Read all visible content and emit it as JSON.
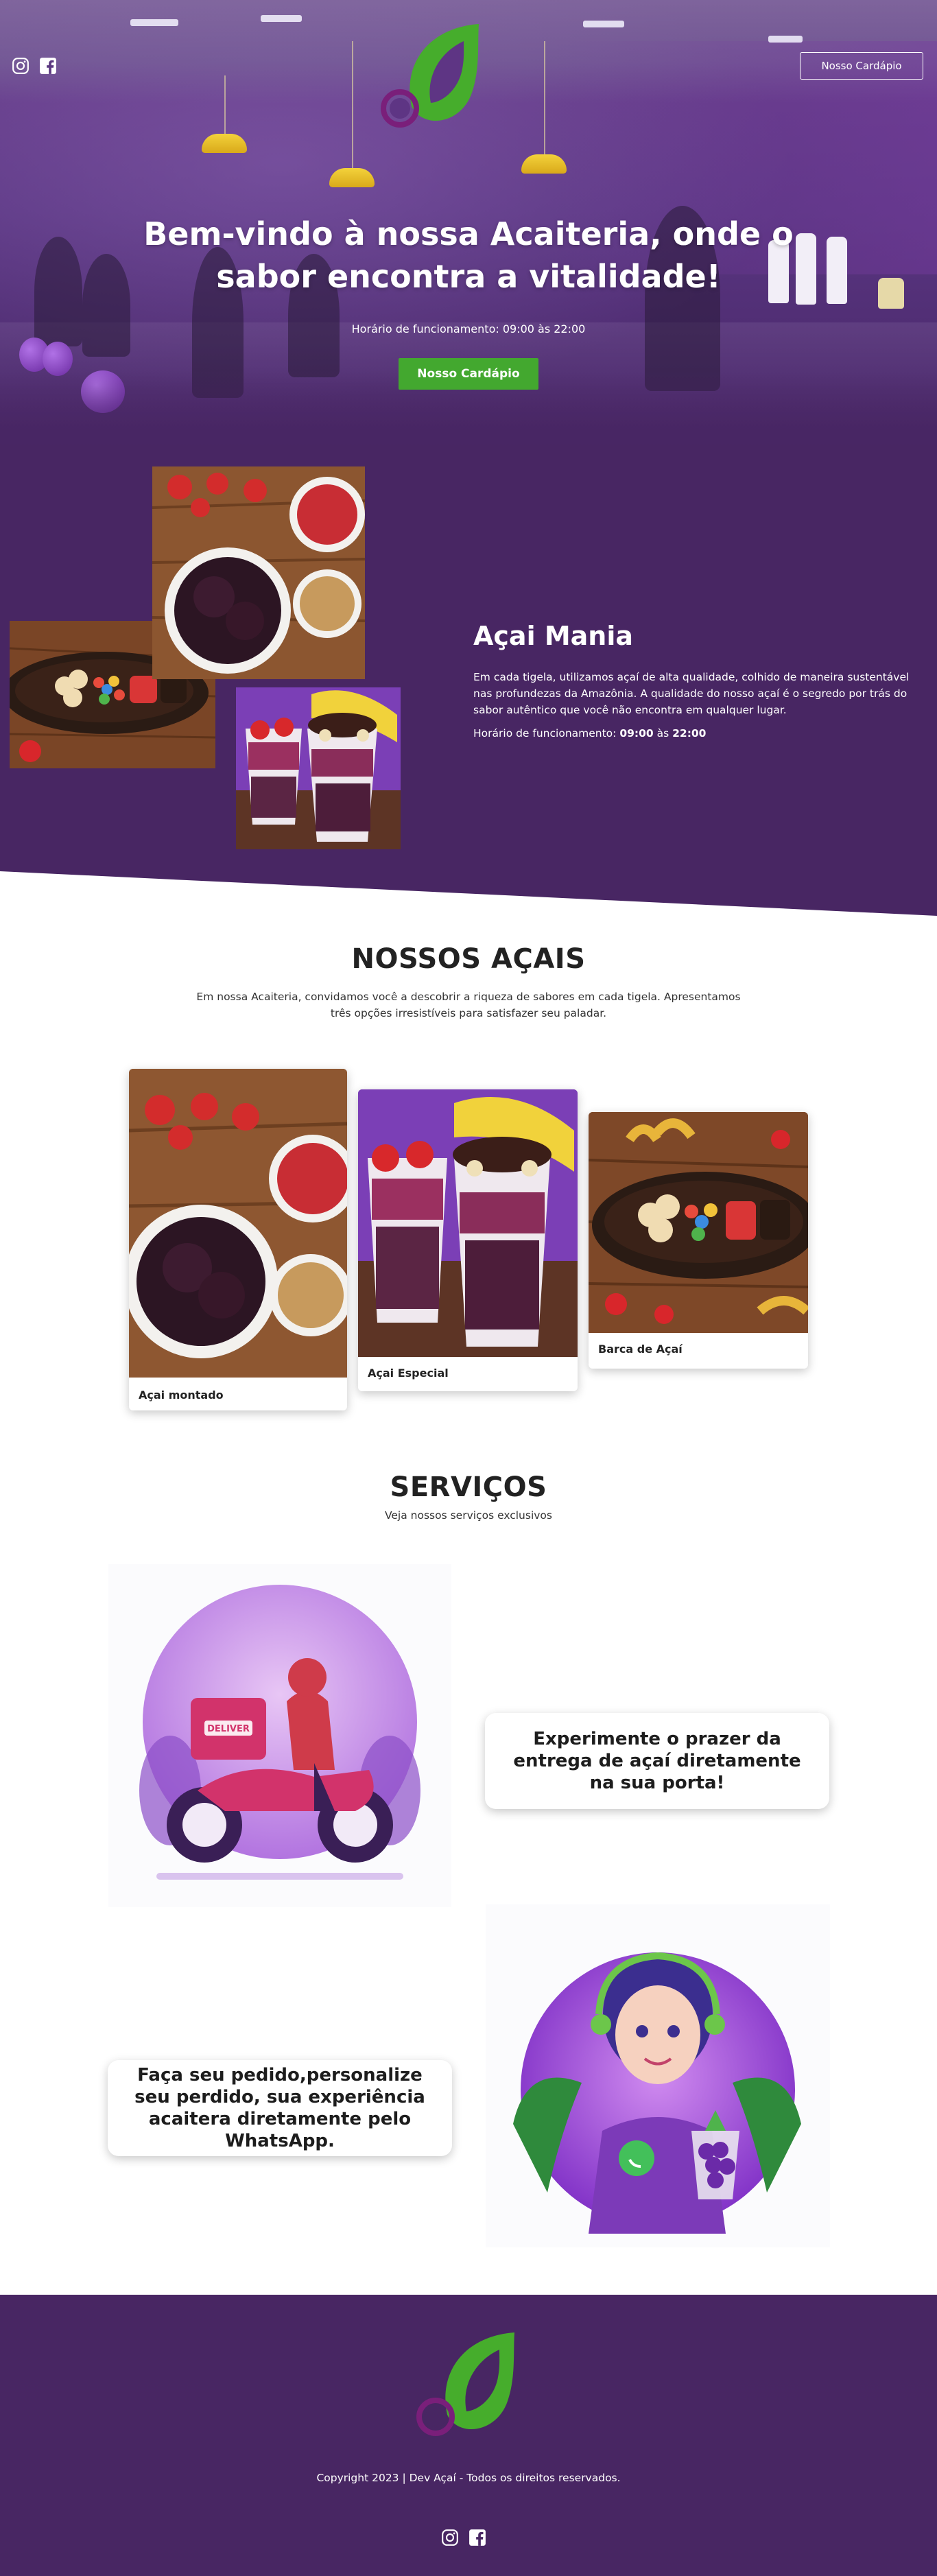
{
  "header": {
    "social_icons": [
      "instagram-icon",
      "facebook-icon"
    ],
    "menu_button_label": "Nosso Cardápio"
  },
  "hero": {
    "title": "Bem-vindo à nossa Acaiteria, onde o sabor encontra a vitalidade!",
    "hours": "Horário de funcionamento: 09:00 às 22:00",
    "cta_label": "Nosso Cardápio"
  },
  "about": {
    "title": "Açai Mania",
    "text": "Em cada tigela, utilizamos açaí de alta qualidade, colhido de maneira sustentável nas profundezas da Amazônia. A qualidade do nosso açaí é o segredo por trás do sabor autêntico que você não encontra em qualquer lugar.",
    "hours_label": "Horário de funcionamento:",
    "hours_open": "09:00",
    "hours_sep": "às",
    "hours_close": "22:00"
  },
  "acais": {
    "title": "NOSSOS AÇAIS",
    "subtitle": "Em nossa Acaiteria, convidamos você a descobrir a riqueza de sabores em cada tigela. Apresentamos três opções irresistíveis para satisfazer seu paladar.",
    "items": [
      {
        "name": "Açai montado"
      },
      {
        "name": "Açai Especial"
      },
      {
        "name": "Barca de Açaí"
      }
    ]
  },
  "servicos": {
    "title": "SERVIÇOS",
    "subtitle": "Veja nossos serviços exclusivos",
    "items": [
      {
        "text": "Experimente o prazer da entrega de açaí diretamente na sua porta!",
        "badge": "DELIVER"
      },
      {
        "text": "Faça seu pedido,personalize seu perdido, sua experiência acaitera diretamente pelo WhatsApp."
      }
    ]
  },
  "footer": {
    "copyright": "Copyright 2023 | Dev Açaí - Todos os direitos reservados.",
    "social_icons": [
      "instagram-icon",
      "facebook-icon"
    ]
  },
  "colors": {
    "brand_purple": "#482663",
    "brand_green": "#43a82f",
    "acai_purple": "#6a2a8a"
  }
}
